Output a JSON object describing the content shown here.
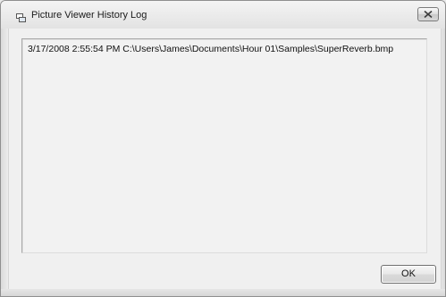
{
  "window": {
    "title": "Picture Viewer History Log",
    "icon": "app-window-icon",
    "close_icon": "close-icon"
  },
  "log": {
    "lines": [
      "3/17/2008 2:55:54 PM C:\\Users\\James\\Documents\\Hour 01\\Samples\\SuperReverb.bmp"
    ]
  },
  "buttons": {
    "ok_label": "OK"
  },
  "colors": {
    "window_bg": "#ececec",
    "text": "#111111",
    "border": "#8f8f8f"
  }
}
